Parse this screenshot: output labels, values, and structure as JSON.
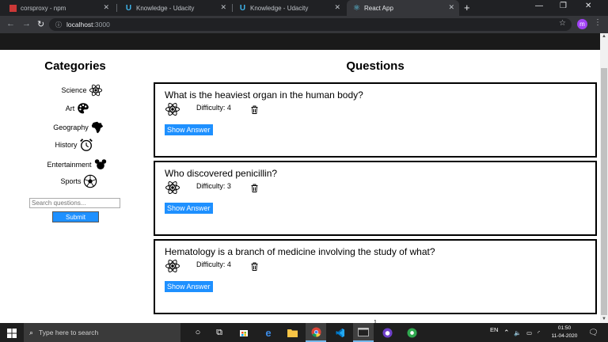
{
  "browser": {
    "tabs": [
      {
        "title": "corsproxy - npm",
        "icon": "npm-icon"
      },
      {
        "title": "Knowledge - Udacity",
        "icon": "udacity-icon"
      },
      {
        "title": "Knowledge - Udacity",
        "icon": "udacity-icon"
      },
      {
        "title": "React App",
        "icon": "react-icon"
      }
    ],
    "active_tab": 3,
    "url_host": "localhost",
    "url_port": ":3000",
    "profile_initial": "m"
  },
  "sidebar": {
    "title": "Categories",
    "categories": [
      {
        "label": "Science",
        "icon": "science-atom-icon"
      },
      {
        "label": "Art",
        "icon": "art-palette-icon"
      },
      {
        "label": "Geography",
        "icon": "geography-africa-icon"
      },
      {
        "label": "History",
        "icon": "history-clock-icon"
      },
      {
        "label": "Entertainment",
        "icon": "entertainment-mouse-icon"
      },
      {
        "label": "Sports",
        "icon": "sports-ball-icon"
      }
    ],
    "search_placeholder": "Search questions...",
    "submit_label": "Submit"
  },
  "main": {
    "title": "Questions",
    "questions": [
      {
        "text": "What is the heaviest organ in the human body?",
        "category_icon": "science-atom-icon",
        "difficulty": "Difficulty: 4",
        "show_answer": "Show Answer"
      },
      {
        "text": "Who discovered penicillin?",
        "category_icon": "science-atom-icon",
        "difficulty": "Difficulty: 3",
        "show_answer": "Show Answer"
      },
      {
        "text": "Hematology is a branch of medicine involving the study of what?",
        "category_icon": "science-atom-icon",
        "difficulty": "Difficulty: 4",
        "show_answer": "Show Answer"
      }
    ],
    "page_number": "1"
  },
  "taskbar": {
    "search_text": "Type here to search",
    "language": "EN",
    "time": "01:50",
    "date": "11-04-2020",
    "accent": "#76b9ed"
  }
}
